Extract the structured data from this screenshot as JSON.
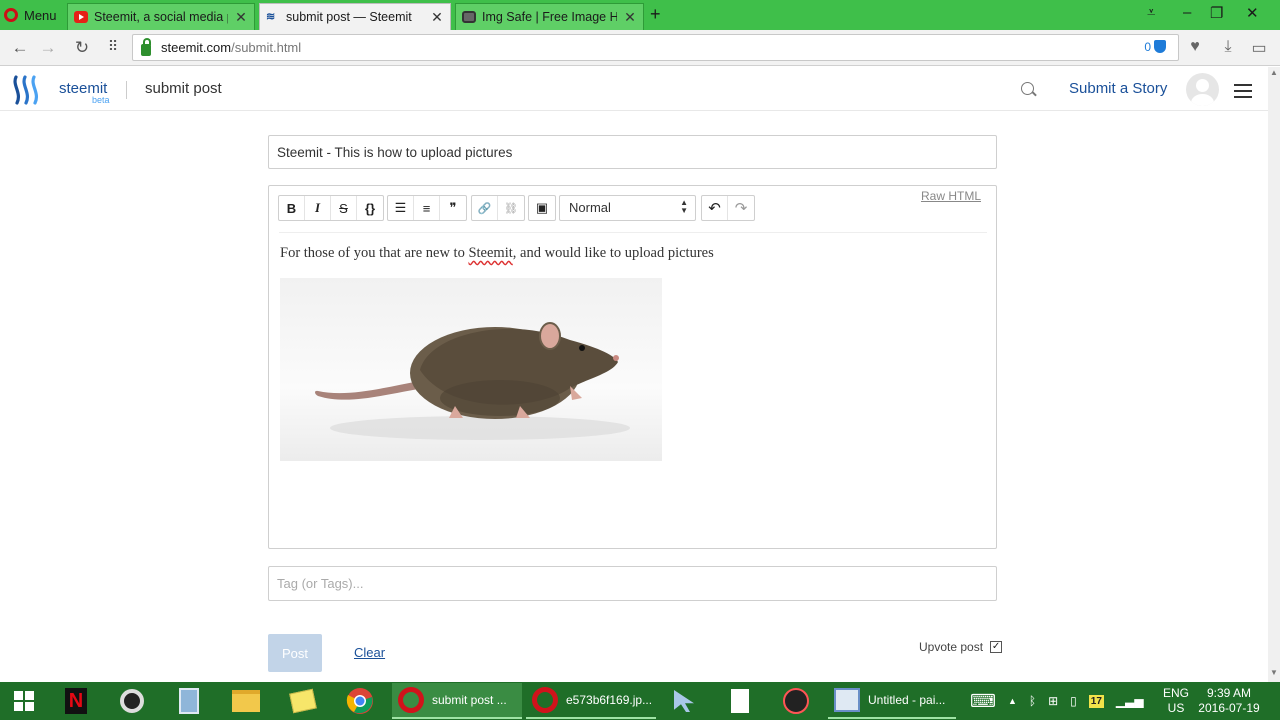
{
  "browser": {
    "menu_label": "Menu",
    "tabs": [
      {
        "title": "Steemit, a social media pla",
        "favicon": "youtube-icon",
        "active": false
      },
      {
        "title": "submit post — Steemit",
        "favicon": "steemit-icon",
        "active": true
      },
      {
        "title": "Img Safe | Free Image Host",
        "favicon": "image-icon",
        "active": false
      }
    ],
    "new_tab": "+",
    "address": {
      "host": "steemit.com",
      "path": "/submit.html"
    },
    "blocked_count": "0"
  },
  "site": {
    "brand": "steemit",
    "beta": "beta",
    "page_title": "submit post",
    "submit_story": "Submit a Story"
  },
  "form": {
    "title_value": "Steemit - This is how to upload pictures",
    "raw_html": "Raw HTML",
    "format_select": "Normal",
    "toolbar_buttons": {
      "bold": "B",
      "italic": "I",
      "strike": "S",
      "code": "{}",
      "bullets": "☰",
      "numbered": "≡",
      "quote": "❞",
      "link": "🔗",
      "unlink": "⛓",
      "image": "▣",
      "undo": "↶",
      "redo": "↷"
    },
    "body_text_before": "For those of you that are new to ",
    "body_text_link": "Steemit",
    "body_text_after": ", and would like to upload pictures",
    "image_subject": "rat",
    "tags_placeholder": "Tag (or Tags)...",
    "post_label": "Post",
    "clear_label": "Clear",
    "upvote_label": "Upvote post",
    "upvote_checked": "✓"
  },
  "taskbar": {
    "apps": [
      {
        "label": "submit post ..."
      },
      {
        "label": "e573b6f169.jp..."
      },
      {
        "label": "Untitled - pai..."
      }
    ],
    "tray": {
      "lang": "ENG",
      "region": "US",
      "time": "9:39 AM",
      "date": "2016-07-19",
      "badge": "17"
    }
  },
  "colors": {
    "opera_green": "#3fbf4a",
    "steemit_blue": "#1a5099",
    "taskbar": "#1f6e28"
  }
}
